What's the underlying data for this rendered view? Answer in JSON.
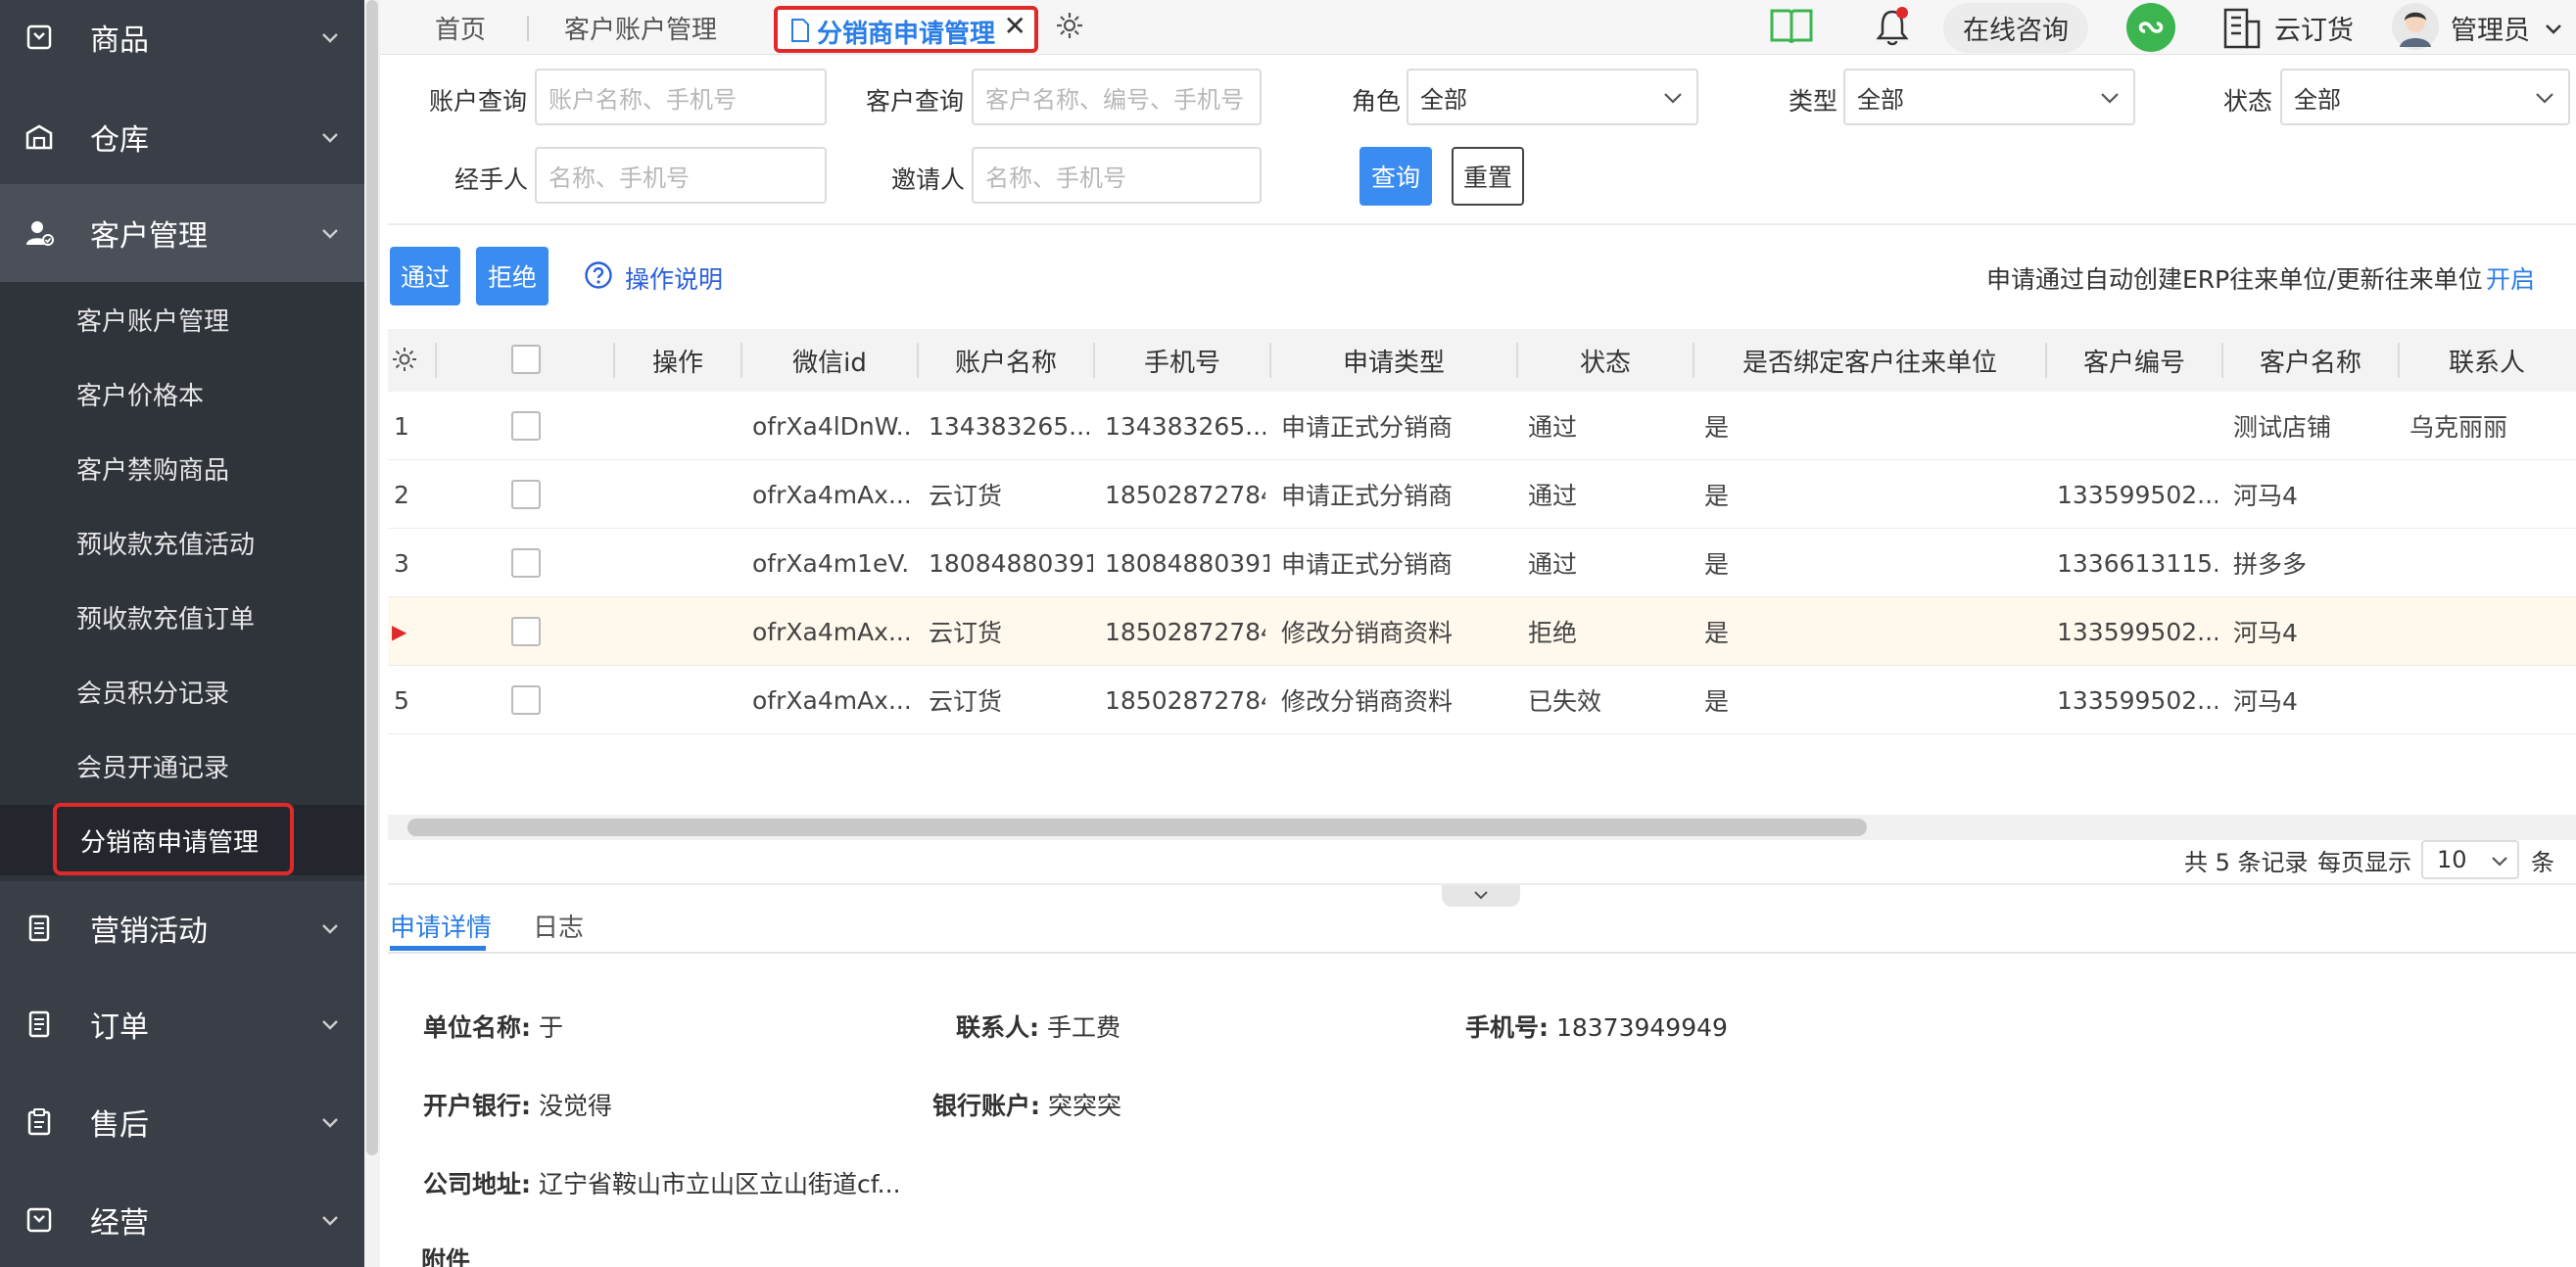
{
  "sidebar": {
    "groups": [
      {
        "label": "商品",
        "icon": "inventory-icon"
      },
      {
        "label": "仓库",
        "icon": "warehouse-icon"
      },
      {
        "label": "客户管理",
        "icon": "user-manage-icon"
      },
      {
        "label": "营销活动",
        "icon": "marketing-icon"
      },
      {
        "label": "订单",
        "icon": "order-icon"
      },
      {
        "label": "售后",
        "icon": "after-sales-icon"
      },
      {
        "label": "经营",
        "icon": "business-icon"
      }
    ],
    "sub_items": [
      {
        "label": "客户账户管理"
      },
      {
        "label": "客户价格本"
      },
      {
        "label": "客户禁购商品"
      },
      {
        "label": "预收款充值活动"
      },
      {
        "label": "预收款充值订单"
      },
      {
        "label": "会员积分记录"
      },
      {
        "label": "会员开通记录"
      },
      {
        "label": "分销商申请管理"
      }
    ],
    "colors": {
      "bg": "#3a3f47",
      "sub_bg": "#2f333a",
      "highlight": "#e02a2a"
    }
  },
  "topbar": {
    "tabs": [
      {
        "label": "首页"
      },
      {
        "label": "客户账户管理"
      },
      {
        "label": "分销商申请管理"
      }
    ],
    "close_symbol": "✕",
    "online_consult": "在线咨询",
    "company": "云订货",
    "user": "管理员"
  },
  "filters": {
    "account_label": "账户查询",
    "account_placeholder": "账户名称、手机号",
    "customer_label": "客户查询",
    "customer_placeholder": "客户名称、编号、手机号",
    "role_label": "角色",
    "role_value": "全部",
    "type_label": "类型",
    "type_value": "全部",
    "status_label": "状态",
    "status_value": "全部",
    "handler_label": "经手人",
    "handler_placeholder": "名称、手机号",
    "inviter_label": "邀请人",
    "inviter_placeholder": "名称、手机号",
    "query_button": "查询",
    "reset_button": "重置"
  },
  "actions": {
    "approve": "通过",
    "reject": "拒绝",
    "help": "操作说明",
    "auto_text": "申请通过自动创建ERP往来单位/更新往来单位",
    "auto_toggle": "开启"
  },
  "table": {
    "headers": [
      "操作",
      "微信id",
      "账户名称",
      "手机号",
      "申请类型",
      "状态",
      "是否绑定客户往来单位",
      "客户编号",
      "客户名称",
      "联系人"
    ],
    "rows": [
      {
        "no": "1",
        "wxid": "ofrXa4lDnW...",
        "account": "134383265...",
        "phone": "134383265...",
        "type": "申请正式分销商",
        "status": "通过",
        "bound": "是",
        "code": "",
        "name": "测试店铺",
        "contact": "乌克丽丽"
      },
      {
        "no": "2",
        "wxid": "ofrXa4mAx...",
        "account": "云订货",
        "phone": "18502872784",
        "type": "申请正式分销商",
        "status": "通过",
        "bound": "是",
        "code": "133599502...",
        "name": "河马4",
        "contact": ""
      },
      {
        "no": "3",
        "wxid": "ofrXa4m1eV...",
        "account": "18084880391",
        "phone": "18084880391",
        "type": "申请正式分销商",
        "status": "通过",
        "bound": "是",
        "code": "1336613115...",
        "name": "拼多多",
        "contact": ""
      },
      {
        "no": "▶",
        "wxid": "ofrXa4mAx...",
        "account": "云订货",
        "phone": "18502872784",
        "type": "修改分销商资料",
        "status": "拒绝",
        "bound": "是",
        "code": "133599502...",
        "name": "河马4",
        "contact": ""
      },
      {
        "no": "5",
        "wxid": "ofrXa4mAx...",
        "account": "云订货",
        "phone": "18502872784",
        "type": "修改分销商资料",
        "status": "已失效",
        "bound": "是",
        "code": "133599502...",
        "name": "河马4",
        "contact": ""
      }
    ],
    "current_row_index": 3
  },
  "pager": {
    "total": "共 5 条记录",
    "per_page_label": "每页显示",
    "per_page_value": "10",
    "unit": "条"
  },
  "detail": {
    "tabs": [
      {
        "label": "申请详情"
      },
      {
        "label": "日志"
      }
    ],
    "unit_name_label": "单位名称:",
    "unit_name": "于",
    "contact_label": "联系人:",
    "contact": "手工费",
    "phone_label": "手机号:",
    "phone": "18373949949",
    "bank_label": "开户银行:",
    "bank": "没觉得",
    "bank_account_label": "银行账户:",
    "bank_account": "突突突",
    "address_label": "公司地址:",
    "address": "辽宁省鞍山市立山区立山街道cf...",
    "attachment_label": "附件"
  }
}
